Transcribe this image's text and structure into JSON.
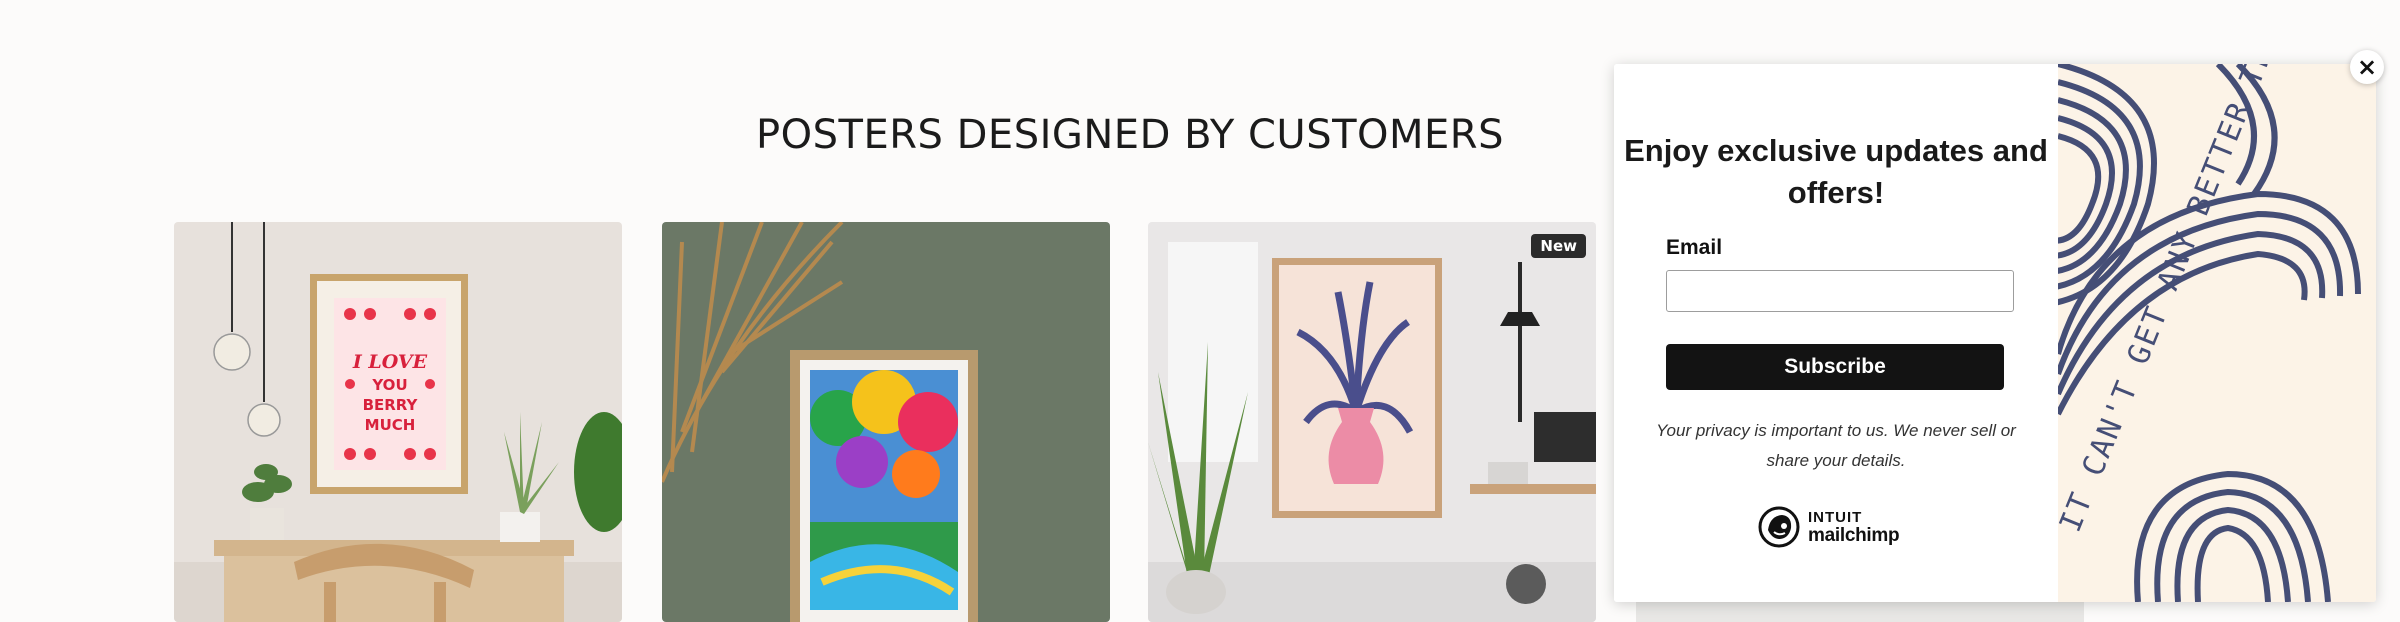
{
  "section": {
    "title": "POSTERS DESIGNED BY CUSTOMERS"
  },
  "cards": [
    {
      "poster_text": "I LOVE YOU BERRY MUCH"
    },
    {
      "poster_text": ""
    },
    {
      "badge": "New"
    }
  ],
  "popup": {
    "heading": "Enjoy exclusive updates and offers!",
    "email_label": "Email",
    "email_value": "",
    "subscribe_label": "Subscribe",
    "privacy_text": "Your privacy is important to us. We never sell or share your details.",
    "logo_line1": "INTUIT",
    "logo_line2": "mailchimp",
    "art_text": "IT CAN'T GET ANY BETTER THAN THIS",
    "close_icon": "close-icon"
  },
  "colors": {
    "card1_wall": "#e7e1dc",
    "card2_wall": "#6b7866",
    "card3_wall": "#e9e7e7",
    "art_bg": "#fcf3e7",
    "art_stripe": "#454e76",
    "button": "#131313"
  }
}
